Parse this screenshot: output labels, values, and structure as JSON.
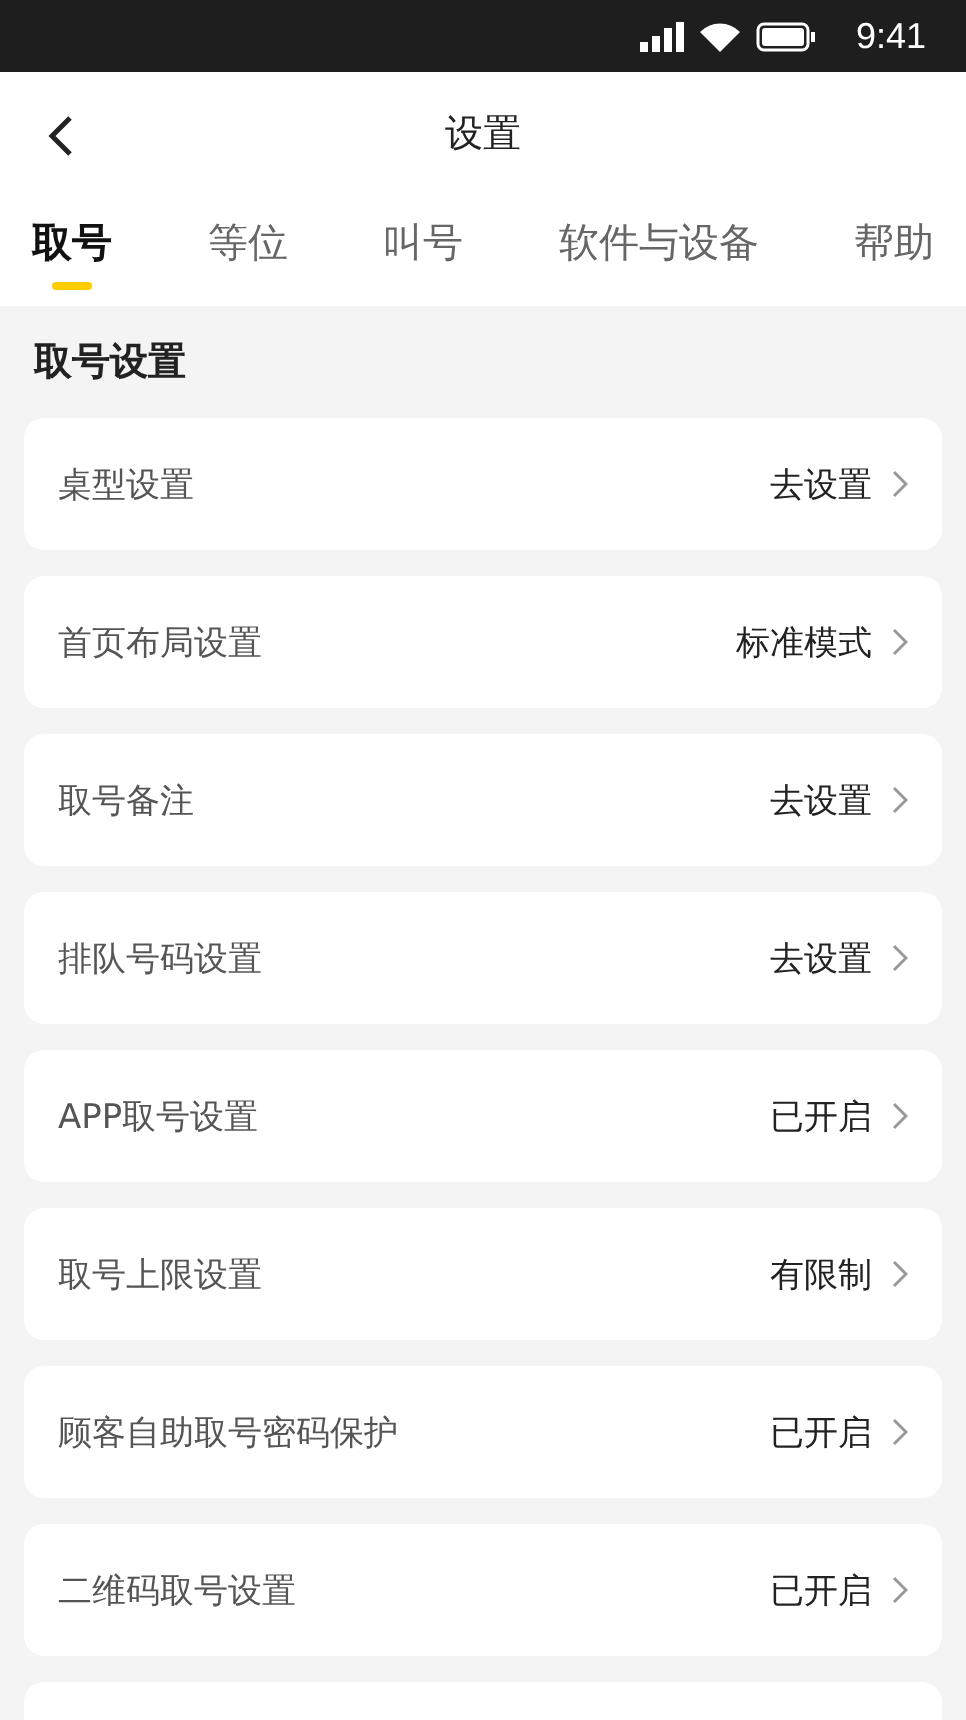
{
  "status_bar": {
    "time": "9:41"
  },
  "nav": {
    "title": "设置"
  },
  "tabs": [
    {
      "label": "取号",
      "selected": true
    },
    {
      "label": "等位",
      "selected": false
    },
    {
      "label": "叫号",
      "selected": false
    },
    {
      "label": "软件与设备",
      "selected": false
    },
    {
      "label": "帮助",
      "selected": false
    }
  ],
  "section": {
    "title": "取号设置"
  },
  "settings": [
    {
      "label": "桌型设置",
      "value": "去设置"
    },
    {
      "label": "首页布局设置",
      "value": "标准模式"
    },
    {
      "label": "取号备注",
      "value": "去设置"
    },
    {
      "label": "排队号码设置",
      "value": "去设置"
    },
    {
      "label": "APP取号设置",
      "value": "已开启"
    },
    {
      "label": "取号上限设置",
      "value": "有限制"
    },
    {
      "label": "顾客自助取号密码保护",
      "value": "已开启"
    },
    {
      "label": "二维码取号设置",
      "value": "已开启"
    }
  ]
}
